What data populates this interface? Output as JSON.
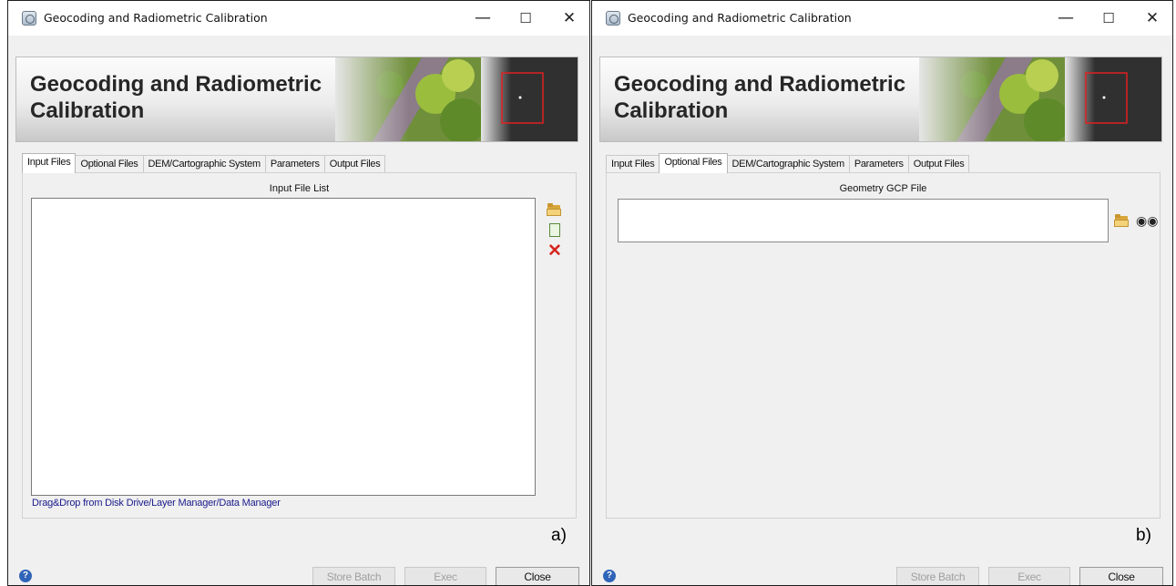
{
  "windows": [
    {
      "title": "Geocoding and Radiometric Calibration",
      "window_controls": {
        "minimize": "—",
        "maximize": "☐",
        "close": "✕"
      },
      "banner": {
        "title": "Geocoding and Radiometric\nCalibration"
      },
      "tabs": [
        {
          "label": "Input Files",
          "active": true
        },
        {
          "label": "Optional Files",
          "active": false
        },
        {
          "label": "DEM/Cartographic System",
          "active": false
        },
        {
          "label": "Parameters",
          "active": false
        },
        {
          "label": "Output Files",
          "active": false
        }
      ],
      "panel": {
        "label": "Input File List",
        "hint": "Drag&Drop from Disk Drive/Layer Manager/Data Manager",
        "side_icons": [
          "open-folder-icon",
          "new-page-icon",
          "delete-x-icon"
        ]
      },
      "corner_label": "a)",
      "buttons": {
        "store_batch": "Store Batch",
        "exec": "Exec",
        "close": "Close"
      },
      "help": "?"
    },
    {
      "title": "Geocoding and Radiometric Calibration",
      "window_controls": {
        "minimize": "—",
        "maximize": "☐",
        "close": "✕"
      },
      "banner": {
        "title": "Geocoding and Radiometric\nCalibration"
      },
      "tabs": [
        {
          "label": "Input Files",
          "active": false
        },
        {
          "label": "Optional Files",
          "active": true
        },
        {
          "label": "DEM/Cartographic System",
          "active": false
        },
        {
          "label": "Parameters",
          "active": false
        },
        {
          "label": "Output Files",
          "active": false
        }
      ],
      "panel": {
        "label": "Geometry GCP File",
        "field_value": "",
        "side_icons": [
          "open-folder-icon",
          "binoculars-icon"
        ]
      },
      "corner_label": "b)",
      "buttons": {
        "store_batch": "Store Batch",
        "exec": "Exec",
        "close": "Close"
      },
      "help": "?"
    }
  ],
  "colors": {
    "window_bg": "#f0f0f0",
    "hint_text": "#1a1a8c",
    "delete_red": "#d6261e",
    "help_blue": "#2f64b8",
    "banner_frame_red": "#e02020"
  }
}
